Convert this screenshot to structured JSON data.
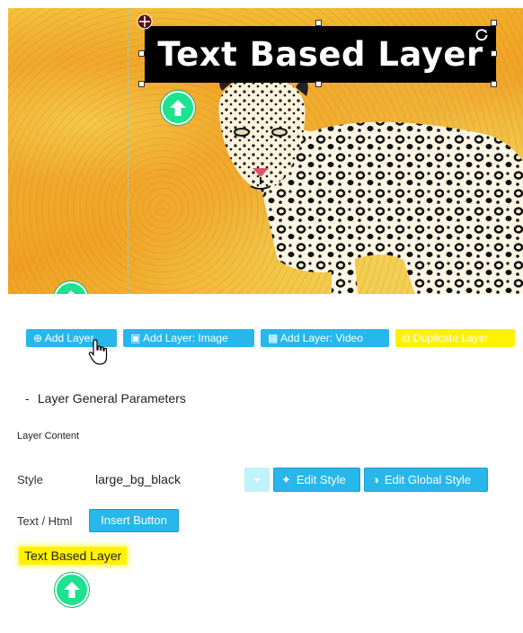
{
  "canvas": {
    "layer_text": "Text Based Layer"
  },
  "toolbar": {
    "add_layer": "Add Layer",
    "add_layer_image": "Add Layer: Image",
    "add_layer_video": "Add Layer: Video",
    "duplicate_layer": "Duplicate Layer"
  },
  "params": {
    "section_title": "Layer General Parameters",
    "layer_content_label": "Layer Content",
    "style_label": "Style",
    "style_value": "large_bg_black",
    "edit_style": "Edit Style",
    "edit_global_style": "Edit Global Style",
    "text_html_label": "Text / Html",
    "insert_button": "Insert Button",
    "text_value": "Text Based Layer"
  },
  "colors": {
    "accent_blue": "#27b7ea",
    "highlight_yellow": "#fff200",
    "arrow_green": "#1de28f"
  },
  "icons": [
    "up-arrow-icon",
    "rotate-icon",
    "origin-icon",
    "hand-cursor-icon",
    "dropdown-icon",
    "magic-wand-icon",
    "palette-icon",
    "plus-icon",
    "image-icon",
    "video-icon",
    "duplicate-icon"
  ]
}
